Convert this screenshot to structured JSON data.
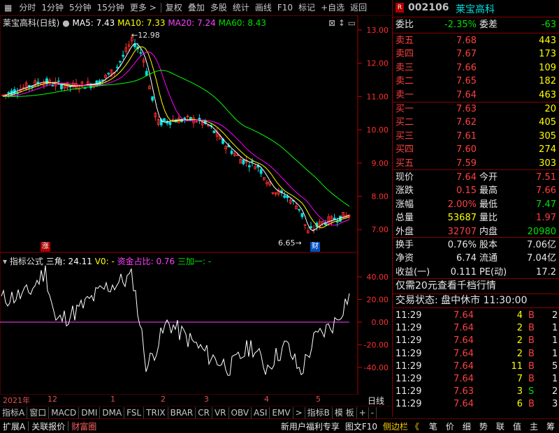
{
  "toolbar": {
    "left_icon": "grid-icon",
    "items": [
      "分时",
      "1分钟",
      "5分钟",
      "15分钟",
      "更多 >",
      "复权",
      "叠加",
      "多股",
      "统计",
      "画线",
      "F10",
      "标记",
      "+自选",
      "返回"
    ]
  },
  "chart": {
    "title": "莱宝高科(日线)",
    "ma5_label": "MA5: 7.43",
    "ma10_label": "MA10: 7.33",
    "ma20_label": "MA20: 7.24",
    "ma60_label": "MA60: 8.43",
    "high_marker": "12.98",
    "low_marker": "6.65",
    "zhang_badge": "涨",
    "cai_badge": "财",
    "y_labels": [
      "13.00",
      "12.00",
      "11.00",
      "10.00",
      "9.00",
      "8.00",
      "7.00"
    ],
    "colors": {
      "ma5": "#ffffff",
      "ma10": "#ffff00",
      "ma20": "#ff00ff",
      "ma60": "#00ff00",
      "axis": "#ff3030"
    }
  },
  "indicator": {
    "title": "指标公式",
    "sanjiao": "三角: 24.11",
    "v0": "V0: -",
    "zijin": "资金占比: 0.76",
    "sanjiayi": "三加一: -",
    "y_labels": [
      "40.00",
      "20.00",
      "0.00",
      "-20.00",
      "-40.00"
    ]
  },
  "dates": [
    "2021年",
    "12",
    "1",
    "2",
    "3",
    "4",
    "5"
  ],
  "ri_xian": "日线",
  "tabs": [
    "指标A",
    "窗口",
    "MACD",
    "DMI",
    "DMA",
    "FSL",
    "TRIX",
    "BRAR",
    "CR",
    "VR",
    "OBV",
    "ASI",
    "EMV",
    ">",
    "指标B",
    "模 板",
    "+",
    "-"
  ],
  "footer": {
    "left": [
      "扩展A",
      "关联报价",
      "财富圈"
    ],
    "right": [
      "新用户福利专享",
      "图文F10",
      "侧边栏 《"
    ],
    "panel_tabs": [
      "笔",
      "价",
      "细",
      "势",
      "联",
      "值",
      "主",
      "筹"
    ]
  },
  "panel": {
    "code": "002106",
    "name": "莱宝高科",
    "weibi_label": "委比",
    "weibi_value": "-2.35%",
    "weicha_label": "委差",
    "weicha_value": "-63",
    "sells": [
      {
        "label": "卖五",
        "price": "7.68",
        "vol": "443"
      },
      {
        "label": "卖四",
        "price": "7.67",
        "vol": "173"
      },
      {
        "label": "卖三",
        "price": "7.66",
        "vol": "109"
      },
      {
        "label": "卖二",
        "price": "7.65",
        "vol": "182"
      },
      {
        "label": "卖一",
        "price": "7.64",
        "vol": "463"
      }
    ],
    "buys": [
      {
        "label": "买一",
        "price": "7.63",
        "vol": "20"
      },
      {
        "label": "买二",
        "price": "7.62",
        "vol": "405"
      },
      {
        "label": "买三",
        "price": "7.61",
        "vol": "305"
      },
      {
        "label": "买四",
        "price": "7.60",
        "vol": "274"
      },
      {
        "label": "买五",
        "price": "7.59",
        "vol": "303"
      }
    ],
    "quote": [
      {
        "l1": "现价",
        "v1": "7.64",
        "l2": "今开",
        "v2": "7.51"
      },
      {
        "l1": "涨跌",
        "v1": "0.15",
        "l2": "最高",
        "v2": "7.66"
      },
      {
        "l1": "涨幅",
        "v1": "2.00%",
        "l2": "最低",
        "v2": "7.47"
      },
      {
        "l1": "总量",
        "v1": "53687",
        "l2": "量比",
        "v2": "1.97"
      },
      {
        "l1": "外盘",
        "v1": "32707",
        "l2": "内盘",
        "v2": "20980"
      }
    ],
    "stats": [
      {
        "l1": "换手",
        "v1": "0.76%",
        "l2": "股本",
        "v2": "7.06亿"
      },
      {
        "l1": "净资",
        "v1": "6.74",
        "l2": "流通",
        "v2": "7.04亿"
      },
      {
        "l1": "收益(一)",
        "v1": "0.111",
        "l2": "PE(动)",
        "v2": "17.2"
      }
    ],
    "promo": "仅需20元查看千档行情",
    "trade_status": "交易状态: 盘中休市  11:30:00",
    "ticks": [
      {
        "t": "11:29",
        "p": "7.64",
        "v": "4",
        "s": "B",
        "n": "2"
      },
      {
        "t": "11:29",
        "p": "7.64",
        "v": "2",
        "s": "B",
        "n": "1"
      },
      {
        "t": "11:29",
        "p": "7.64",
        "v": "2",
        "s": "B",
        "n": "1"
      },
      {
        "t": "11:29",
        "p": "7.64",
        "v": "2",
        "s": "B",
        "n": "1"
      },
      {
        "t": "11:29",
        "p": "7.64",
        "v": "11",
        "s": "B",
        "n": "5"
      },
      {
        "t": "11:29",
        "p": "7.64",
        "v": "7",
        "s": "B",
        "n": "1"
      },
      {
        "t": "11:29",
        "p": "7.63",
        "v": "3",
        "s": "S",
        "n": "2"
      },
      {
        "t": "11:29",
        "p": "7.64",
        "v": "6",
        "s": "B",
        "n": "3"
      }
    ]
  }
}
